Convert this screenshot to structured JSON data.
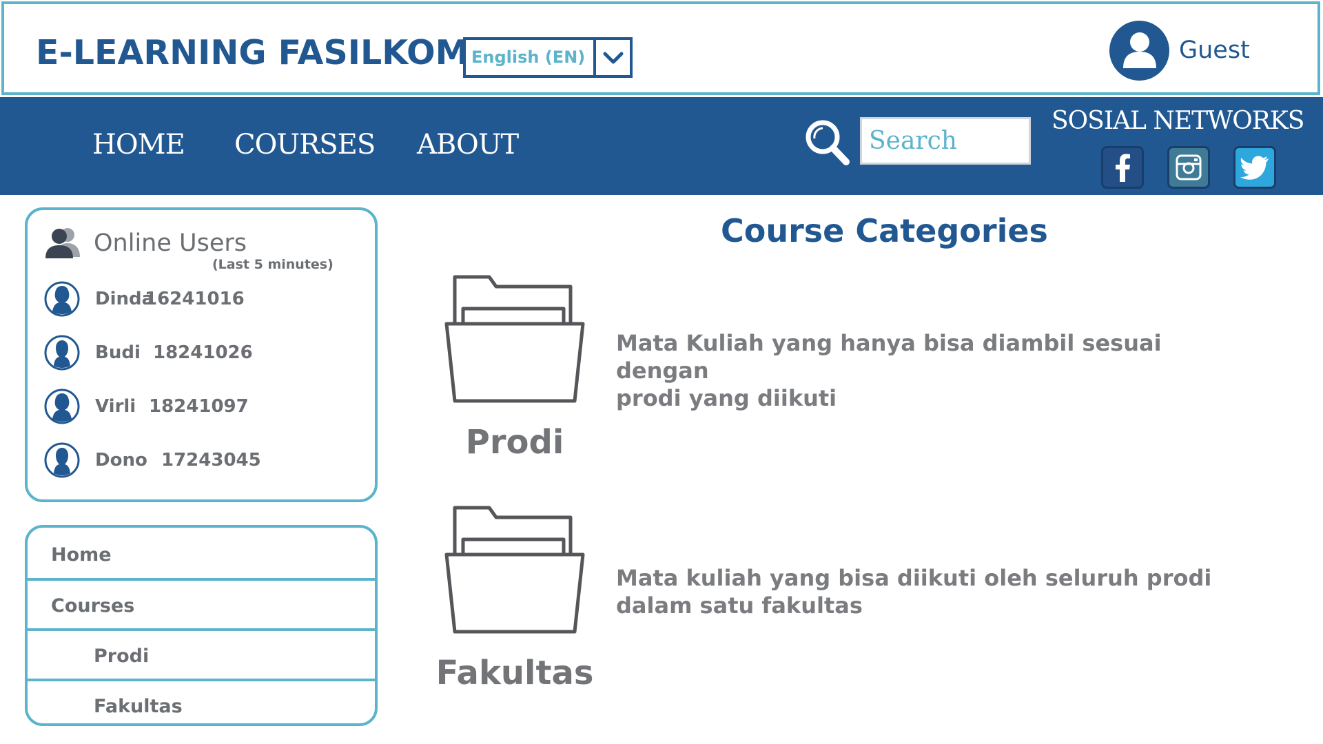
{
  "header": {
    "site_title": "E-LEARNING FASILKOM",
    "language": "English (EN)",
    "user_name": "Guest"
  },
  "nav": {
    "items": [
      {
        "label": "HOME"
      },
      {
        "label": "COURSES"
      },
      {
        "label": "ABOUT"
      }
    ],
    "search_placeholder": "Search",
    "social_title": "SOSIAL NETWORKS",
    "social": [
      "facebook-icon",
      "instagram-icon",
      "twitter-icon"
    ]
  },
  "online_users": {
    "title": "Online Users",
    "subtitle": "(Last 5 minutes)",
    "users": [
      {
        "name": "Dinda",
        "id": "16241016",
        "gender": "female"
      },
      {
        "name": "Budi",
        "id": "18241026",
        "gender": "male"
      },
      {
        "name": "Virli",
        "id": "18241097",
        "gender": "female"
      },
      {
        "name": "Dono",
        "id": "17243045",
        "gender": "male"
      }
    ]
  },
  "side_menu": {
    "items": [
      {
        "label": "Home",
        "level": 0
      },
      {
        "label": "Courses",
        "level": 0
      },
      {
        "label": "Prodi",
        "level": 1
      },
      {
        "label": "Fakultas",
        "level": 1
      }
    ]
  },
  "main": {
    "title": "Course Categories",
    "categories": [
      {
        "label": "Prodi",
        "description_line1": "Mata Kuliah yang hanya bisa diambil sesuai dengan",
        "description_line2": "prodi yang diikuti"
      },
      {
        "label": "Fakultas",
        "description_line1": "Mata kuliah yang bisa diikuti oleh seluruh prodi",
        "description_line2": "dalam satu fakultas"
      }
    ]
  },
  "colors": {
    "primary": "#215891",
    "accent": "#5bb3cc",
    "text_gray": "#6b6e72"
  }
}
